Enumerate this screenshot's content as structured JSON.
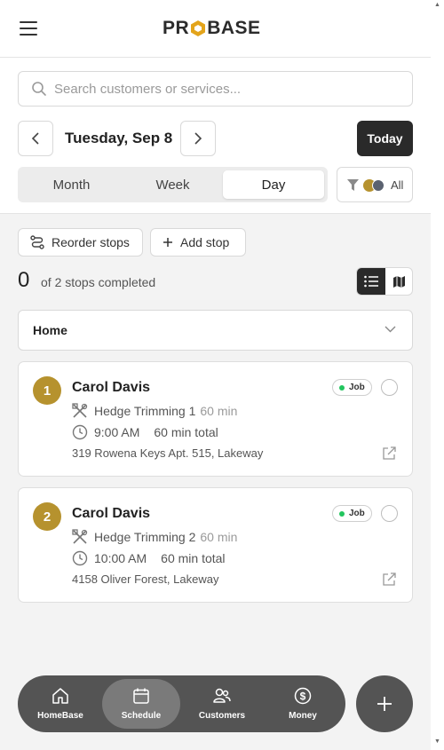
{
  "app": {
    "logo_text_left": "PR",
    "logo_text_right": "BASE"
  },
  "colors": {
    "accent_gold": "#b6922e",
    "dark": "#2a2a2a",
    "job_dot": "#22c55e"
  },
  "search": {
    "placeholder": "Search customers or services..."
  },
  "schedule": {
    "date": "Tuesday, Sep 8",
    "today_label": "Today",
    "views": [
      "Month",
      "Week",
      "Day"
    ],
    "active_view": "Day",
    "filter_label": "All"
  },
  "actions": {
    "reorder_label": "Reorder stops",
    "add_label": "Add stop"
  },
  "progress": {
    "completed": "0",
    "text": "of 2 stops completed"
  },
  "location": {
    "selected": "Home"
  },
  "stops": [
    {
      "number": "1",
      "name": "Carol Davis",
      "badge": "Job",
      "service": "Hedge Trimming 1",
      "service_duration": "60 min",
      "time": "9:00 AM",
      "total": "60 min total",
      "address": "319 Rowena Keys Apt. 515, Lakeway"
    },
    {
      "number": "2",
      "name": "Carol Davis",
      "badge": "Job",
      "service": "Hedge Trimming 2",
      "service_duration": "60 min",
      "time": "10:00 AM",
      "total": "60 min total",
      "address": "4158 Oliver Forest, Lakeway"
    }
  ],
  "bottom_nav": {
    "items": [
      {
        "label": "HomeBase",
        "icon": "home-icon"
      },
      {
        "label": "Schedule",
        "icon": "calendar-icon"
      },
      {
        "label": "Customers",
        "icon": "users-icon"
      },
      {
        "label": "Money",
        "icon": "dollar-icon"
      }
    ],
    "active": "Schedule"
  }
}
